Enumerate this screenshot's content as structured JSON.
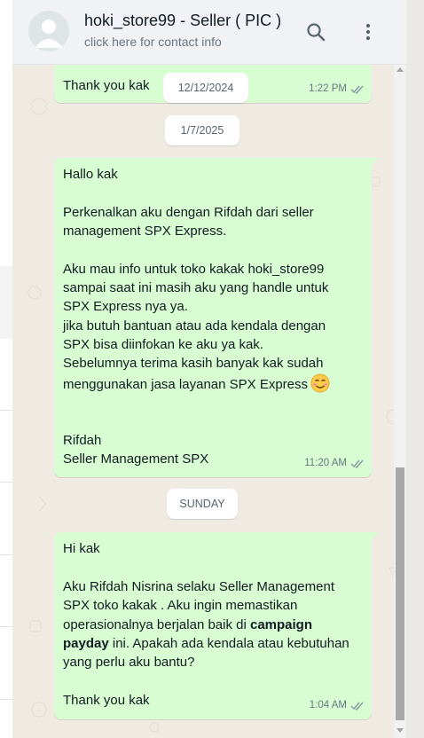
{
  "colors": {
    "bubble": "#d9fdd3",
    "chat_bg": "#efeae2",
    "header_bg": "#f0f2f5",
    "tick": "#8696a0"
  },
  "header": {
    "title": "hoki_store99 - Seller ( PIC )",
    "subtitle": "click here for contact info",
    "icons": [
      "search-icon",
      "kebab-menu-icon"
    ]
  },
  "messages": [
    {
      "lines": [
        "Thank you kak"
      ],
      "time": "1:22 PM",
      "status": "read"
    },
    {
      "lines": [
        "Hallo kak",
        "",
        "Perkenalkan aku dengan Rifdah dari seller",
        "management SPX Express.",
        "",
        "Aku mau info untuk toko kakak hoki_store99",
        "sampai saat ini masih aku yang handle untuk",
        "SPX Express nya ya.",
        "jika butuh bantuan atau ada kendala dengan",
        "SPX bisa diinfokan ke aku ya kak.",
        "Sebelumnya terima kasih banyak kak sudah",
        "menggunakan jasa layanan SPX Express",
        "",
        "",
        "Rifdah",
        "Seller Management SPX"
      ],
      "emoji": "smiling-face-emoji",
      "time": "11:20 AM",
      "status": "read"
    },
    {
      "lines": [
        "Hi kak",
        "",
        "Aku Rifdah Nisrina selaku Seller Management",
        "SPX toko kakak . Aku ingin memastikan",
        "operasionalnya berjalan baik di",
        "campaign",
        "payday",
        "ini. Apakah ada kendala atau kebutuhan",
        "yang perlu aku bantu?",
        "",
        "Thank you kak"
      ],
      "time": "1:04 AM",
      "status": "read"
    }
  ],
  "date_chips": [
    "12/12/2024",
    "1/7/2025",
    "SUNDAY"
  ]
}
